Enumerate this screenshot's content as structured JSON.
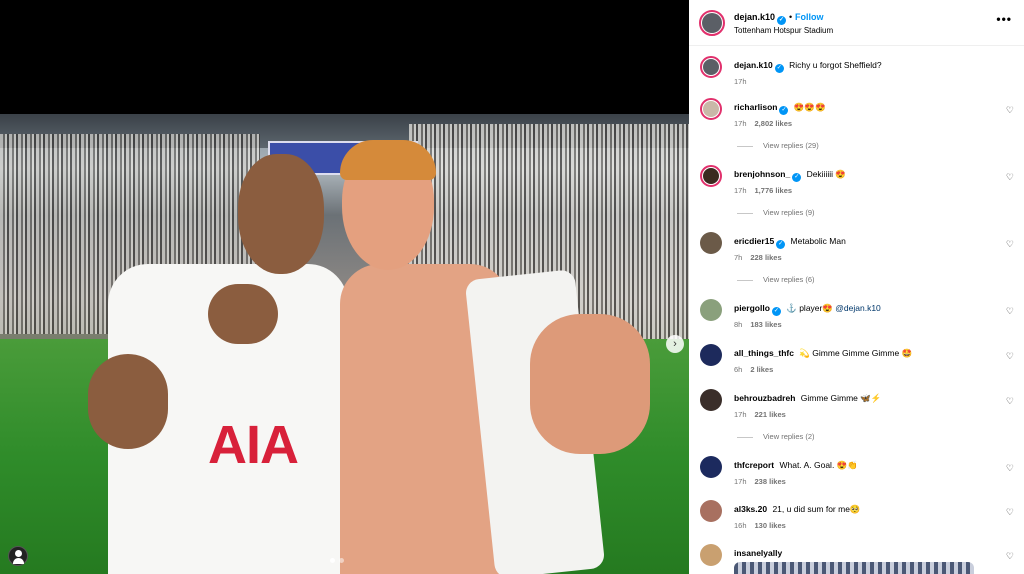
{
  "post": {
    "username": "dejan.k10",
    "follow_label": "Follow",
    "separator": "•",
    "location": "Tottenham Hotspur Stadium",
    "more_label": "•••",
    "image_shirt_text": "AIA",
    "carousel_dots": 2,
    "next_label": "›"
  },
  "comments": [
    {
      "user": "dejan.k10",
      "verified": true,
      "text": "Richy u forgot Sheffield?",
      "time": "17h",
      "likes": "",
      "replies": "",
      "avatar_color": "#5b5f66",
      "ring": true
    },
    {
      "user": "richarlison",
      "verified": true,
      "text": "😍😍😍",
      "time": "17h",
      "likes": "2,802 likes",
      "replies": "View replies (29)",
      "avatar_color": "#c9b8a8",
      "ring": true
    },
    {
      "user": "brenjohnson_",
      "verified": true,
      "text": "Dekiiiiii 😍",
      "time": "17h",
      "likes": "1,776 likes",
      "replies": "View replies (9)",
      "avatar_color": "#3b2a1f",
      "ring": true
    },
    {
      "user": "ericdier15",
      "verified": true,
      "text": "Metabolic Man",
      "time": "7h",
      "likes": "228 likes",
      "replies": "View replies (6)",
      "avatar_color": "#6b5a48",
      "ring": false
    },
    {
      "user": "piergollo",
      "verified": true,
      "text": "⚓ player😍 ",
      "mention": "@dejan.k10",
      "time": "8h",
      "likes": "183 likes",
      "replies": "",
      "avatar_color": "#8aa07c",
      "ring": false
    },
    {
      "user": "all_things_thfc",
      "verified": false,
      "text": "💫 Gimme Gimme Gimme 🤩",
      "time": "6h",
      "likes": "2 likes",
      "replies": "",
      "avatar_color": "#1d2a5c",
      "ring": false
    },
    {
      "user": "behrouzbadreh",
      "verified": false,
      "text": "Gimme Gimme 🦋⚡",
      "time": "17h",
      "likes": "221 likes",
      "replies": "View replies (2)",
      "avatar_color": "#3a2e2a",
      "ring": false
    },
    {
      "user": "thfcreport",
      "verified": false,
      "text": "What. A. Goal. 😍👏",
      "time": "17h",
      "likes": "238 likes",
      "replies": "",
      "avatar_color": "#1c2a5e",
      "ring": false
    },
    {
      "user": "al3ks.20",
      "verified": false,
      "text": "21, u did sum for me🥺",
      "time": "16h",
      "likes": "130 likes",
      "replies": "",
      "avatar_color": "#a87060",
      "ring": false
    },
    {
      "user": "insanelyally",
      "verified": false,
      "text": "",
      "time": "",
      "likes": "",
      "replies": "",
      "avatar_color": "#c9a070",
      "ring": false
    }
  ],
  "heart_label": "♡"
}
